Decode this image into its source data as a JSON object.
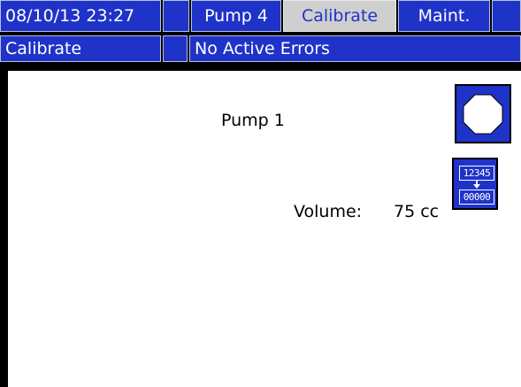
{
  "header": {
    "datetime": "08/10/13 23:27",
    "tabs": [
      {
        "label": "Pump 4"
      },
      {
        "label": "Calibrate"
      },
      {
        "label": "Maint."
      }
    ]
  },
  "status": {
    "screen_name": "Calibrate",
    "error_text": "No Active Errors"
  },
  "main": {
    "pump_label": "Pump 1",
    "volume_label": "Volume:",
    "volume_value": "75 cc"
  },
  "buttons": {
    "stop": {
      "icon": "stop-octagon-icon"
    },
    "reset": {
      "icon": "reset-counter-icon",
      "top_digits": "12345",
      "bottom_digits": "00000"
    }
  },
  "colors": {
    "bar_blue": "#1f33c9",
    "active_tab": "#cfcfcf",
    "background": "#ffffff",
    "frame": "#000000"
  }
}
